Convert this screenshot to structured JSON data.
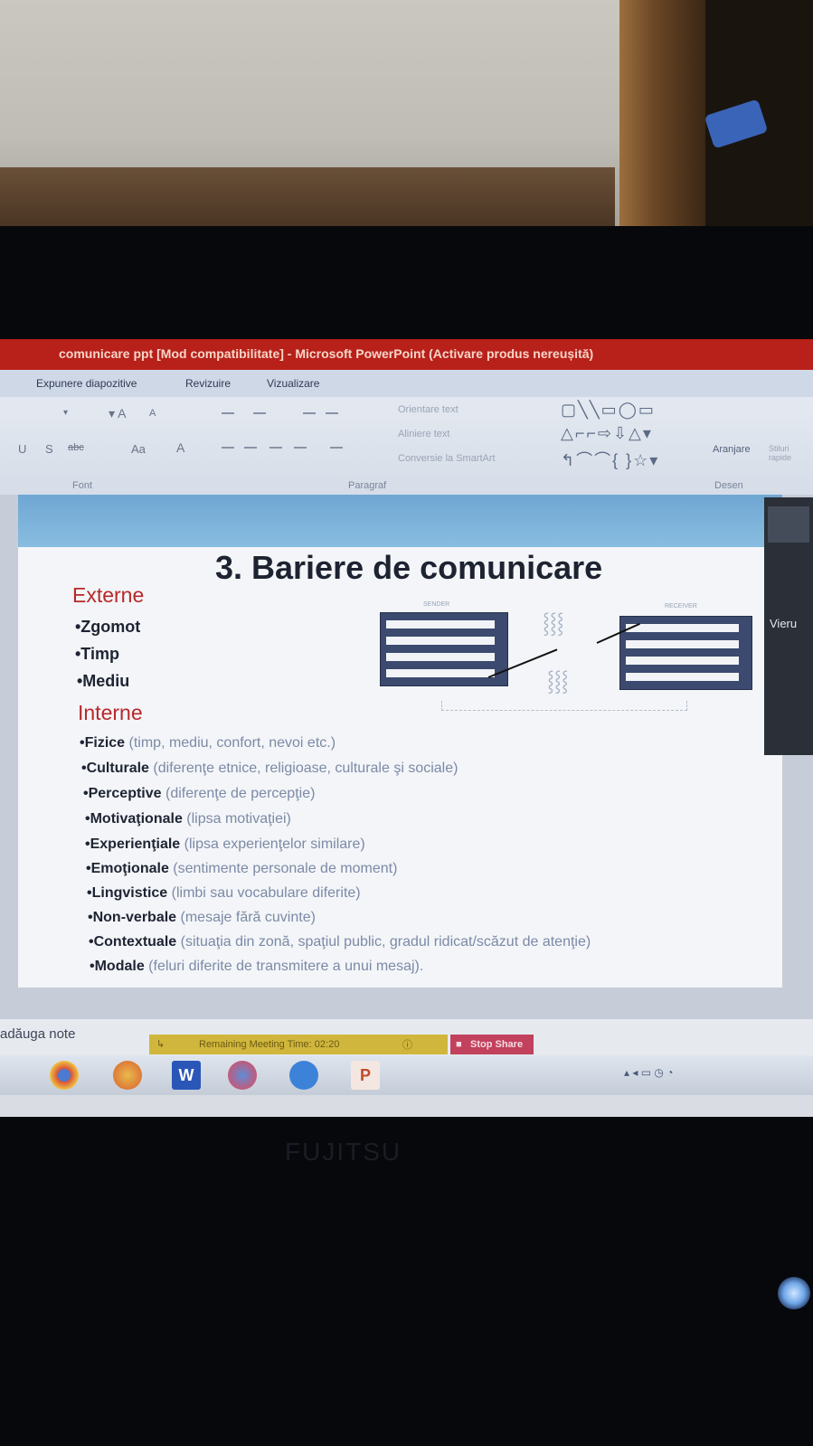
{
  "window": {
    "title": "comunicare ppt [Mod compatibilitate] - Microsoft PowerPoint (Activare produs nereușită)"
  },
  "ribbon_tabs": [
    "Expunere diapozitive",
    "Revizuire",
    "Vizualizare"
  ],
  "ribbon": {
    "font_group": "Font",
    "paragraph_group": "Paragraf",
    "drawing_group": "Desen",
    "text_direction": "Orientare text",
    "align_text": "Aliniere text",
    "convert_smartart": "Conversie la SmartArt",
    "arrange": "Aranjare",
    "quick_styles": "Stiluri rapide"
  },
  "slide": {
    "title": "3. Bariere de comunicare",
    "external_heading": "Externe",
    "external_items": [
      "•Zgomot",
      "•Timp",
      "•Mediu"
    ],
    "internal_heading": "Interne",
    "internal_items": [
      {
        "term": "•Fizice",
        "detail": " (timp, mediu, confort, nevoi etc.)"
      },
      {
        "term": "•Culturale",
        "detail": " (diferenţe etnice, religioase, culturale şi sociale)"
      },
      {
        "term": "•Perceptive",
        "detail": " (diferenţe de percepţie)"
      },
      {
        "term": "•Motivaţionale",
        "detail": " (lipsa motivaţiei)"
      },
      {
        "term": "•Experienţiale",
        "detail": " (lipsa experienţelor similare)"
      },
      {
        "term": "•Emoţionale",
        "detail": " (sentimente personale de moment)"
      },
      {
        "term": "•Lingvistice",
        "detail": " (limbi sau vocabulare diferite)"
      },
      {
        "term": "•Non-verbale",
        "detail": " (mesaje fără cuvinte)"
      },
      {
        "term": "•Contextuale",
        "detail": " (situaţia din zonă, spaţiul public, gradul ridicat/scăzut de atenţie)"
      },
      {
        "term": "•Modale",
        "detail": " (feluri diferite de transmitere a unui mesaj)."
      }
    ],
    "diagram": {
      "sender_label": "SENDER",
      "receiver_label": "RECEIVER"
    }
  },
  "side_panel": {
    "label": "Vieru"
  },
  "notes_placeholder": "adăuga note",
  "meeting": {
    "remaining": "Remaining Meeting Time: 02:20",
    "stop_share": "Stop Share"
  },
  "monitor_brand": "FUJITSU",
  "colors": {
    "title_bar": "#b8201a",
    "heading_red": "#b8282a",
    "slide_band": "#6fa7d3",
    "meeting_bar": "#d0b63c",
    "stop_share": "#c2415d"
  },
  "taskbar_icons": [
    "chrome-icon",
    "chrome-icon",
    "word-icon",
    "chrome-icon",
    "zoom-icon",
    "powerpoint-icon"
  ]
}
